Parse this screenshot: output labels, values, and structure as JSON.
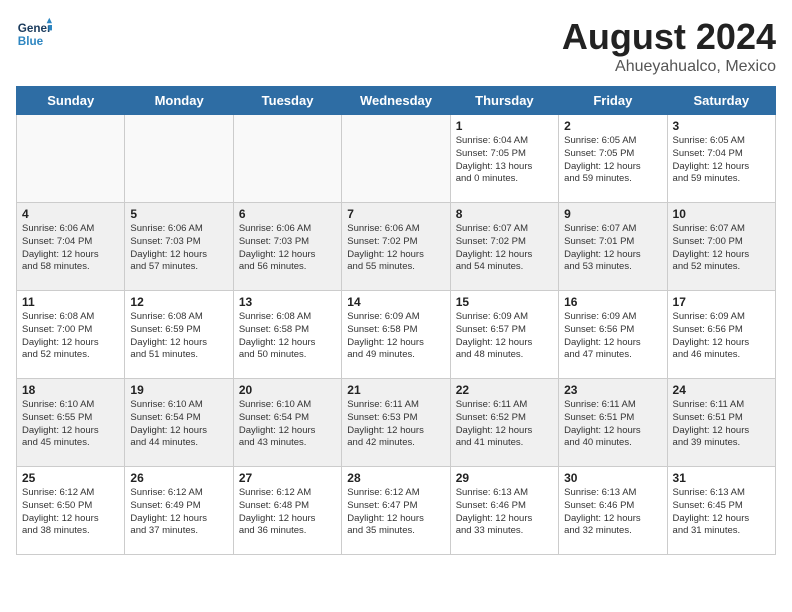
{
  "logo": {
    "line1": "General",
    "line2": "Blue"
  },
  "title": "August 2024",
  "subtitle": "Ahueyahualco, Mexico",
  "days_of_week": [
    "Sunday",
    "Monday",
    "Tuesday",
    "Wednesday",
    "Thursday",
    "Friday",
    "Saturday"
  ],
  "weeks": [
    [
      {
        "day": "",
        "info": ""
      },
      {
        "day": "",
        "info": ""
      },
      {
        "day": "",
        "info": ""
      },
      {
        "day": "",
        "info": ""
      },
      {
        "day": "1",
        "info": "Sunrise: 6:04 AM\nSunset: 7:05 PM\nDaylight: 13 hours\nand 0 minutes."
      },
      {
        "day": "2",
        "info": "Sunrise: 6:05 AM\nSunset: 7:05 PM\nDaylight: 12 hours\nand 59 minutes."
      },
      {
        "day": "3",
        "info": "Sunrise: 6:05 AM\nSunset: 7:04 PM\nDaylight: 12 hours\nand 59 minutes."
      }
    ],
    [
      {
        "day": "4",
        "info": "Sunrise: 6:06 AM\nSunset: 7:04 PM\nDaylight: 12 hours\nand 58 minutes."
      },
      {
        "day": "5",
        "info": "Sunrise: 6:06 AM\nSunset: 7:03 PM\nDaylight: 12 hours\nand 57 minutes."
      },
      {
        "day": "6",
        "info": "Sunrise: 6:06 AM\nSunset: 7:03 PM\nDaylight: 12 hours\nand 56 minutes."
      },
      {
        "day": "7",
        "info": "Sunrise: 6:06 AM\nSunset: 7:02 PM\nDaylight: 12 hours\nand 55 minutes."
      },
      {
        "day": "8",
        "info": "Sunrise: 6:07 AM\nSunset: 7:02 PM\nDaylight: 12 hours\nand 54 minutes."
      },
      {
        "day": "9",
        "info": "Sunrise: 6:07 AM\nSunset: 7:01 PM\nDaylight: 12 hours\nand 53 minutes."
      },
      {
        "day": "10",
        "info": "Sunrise: 6:07 AM\nSunset: 7:00 PM\nDaylight: 12 hours\nand 52 minutes."
      }
    ],
    [
      {
        "day": "11",
        "info": "Sunrise: 6:08 AM\nSunset: 7:00 PM\nDaylight: 12 hours\nand 52 minutes."
      },
      {
        "day": "12",
        "info": "Sunrise: 6:08 AM\nSunset: 6:59 PM\nDaylight: 12 hours\nand 51 minutes."
      },
      {
        "day": "13",
        "info": "Sunrise: 6:08 AM\nSunset: 6:58 PM\nDaylight: 12 hours\nand 50 minutes."
      },
      {
        "day": "14",
        "info": "Sunrise: 6:09 AM\nSunset: 6:58 PM\nDaylight: 12 hours\nand 49 minutes."
      },
      {
        "day": "15",
        "info": "Sunrise: 6:09 AM\nSunset: 6:57 PM\nDaylight: 12 hours\nand 48 minutes."
      },
      {
        "day": "16",
        "info": "Sunrise: 6:09 AM\nSunset: 6:56 PM\nDaylight: 12 hours\nand 47 minutes."
      },
      {
        "day": "17",
        "info": "Sunrise: 6:09 AM\nSunset: 6:56 PM\nDaylight: 12 hours\nand 46 minutes."
      }
    ],
    [
      {
        "day": "18",
        "info": "Sunrise: 6:10 AM\nSunset: 6:55 PM\nDaylight: 12 hours\nand 45 minutes."
      },
      {
        "day": "19",
        "info": "Sunrise: 6:10 AM\nSunset: 6:54 PM\nDaylight: 12 hours\nand 44 minutes."
      },
      {
        "day": "20",
        "info": "Sunrise: 6:10 AM\nSunset: 6:54 PM\nDaylight: 12 hours\nand 43 minutes."
      },
      {
        "day": "21",
        "info": "Sunrise: 6:11 AM\nSunset: 6:53 PM\nDaylight: 12 hours\nand 42 minutes."
      },
      {
        "day": "22",
        "info": "Sunrise: 6:11 AM\nSunset: 6:52 PM\nDaylight: 12 hours\nand 41 minutes."
      },
      {
        "day": "23",
        "info": "Sunrise: 6:11 AM\nSunset: 6:51 PM\nDaylight: 12 hours\nand 40 minutes."
      },
      {
        "day": "24",
        "info": "Sunrise: 6:11 AM\nSunset: 6:51 PM\nDaylight: 12 hours\nand 39 minutes."
      }
    ],
    [
      {
        "day": "25",
        "info": "Sunrise: 6:12 AM\nSunset: 6:50 PM\nDaylight: 12 hours\nand 38 minutes."
      },
      {
        "day": "26",
        "info": "Sunrise: 6:12 AM\nSunset: 6:49 PM\nDaylight: 12 hours\nand 37 minutes."
      },
      {
        "day": "27",
        "info": "Sunrise: 6:12 AM\nSunset: 6:48 PM\nDaylight: 12 hours\nand 36 minutes."
      },
      {
        "day": "28",
        "info": "Sunrise: 6:12 AM\nSunset: 6:47 PM\nDaylight: 12 hours\nand 35 minutes."
      },
      {
        "day": "29",
        "info": "Sunrise: 6:13 AM\nSunset: 6:46 PM\nDaylight: 12 hours\nand 33 minutes."
      },
      {
        "day": "30",
        "info": "Sunrise: 6:13 AM\nSunset: 6:46 PM\nDaylight: 12 hours\nand 32 minutes."
      },
      {
        "day": "31",
        "info": "Sunrise: 6:13 AM\nSunset: 6:45 PM\nDaylight: 12 hours\nand 31 minutes."
      }
    ]
  ]
}
